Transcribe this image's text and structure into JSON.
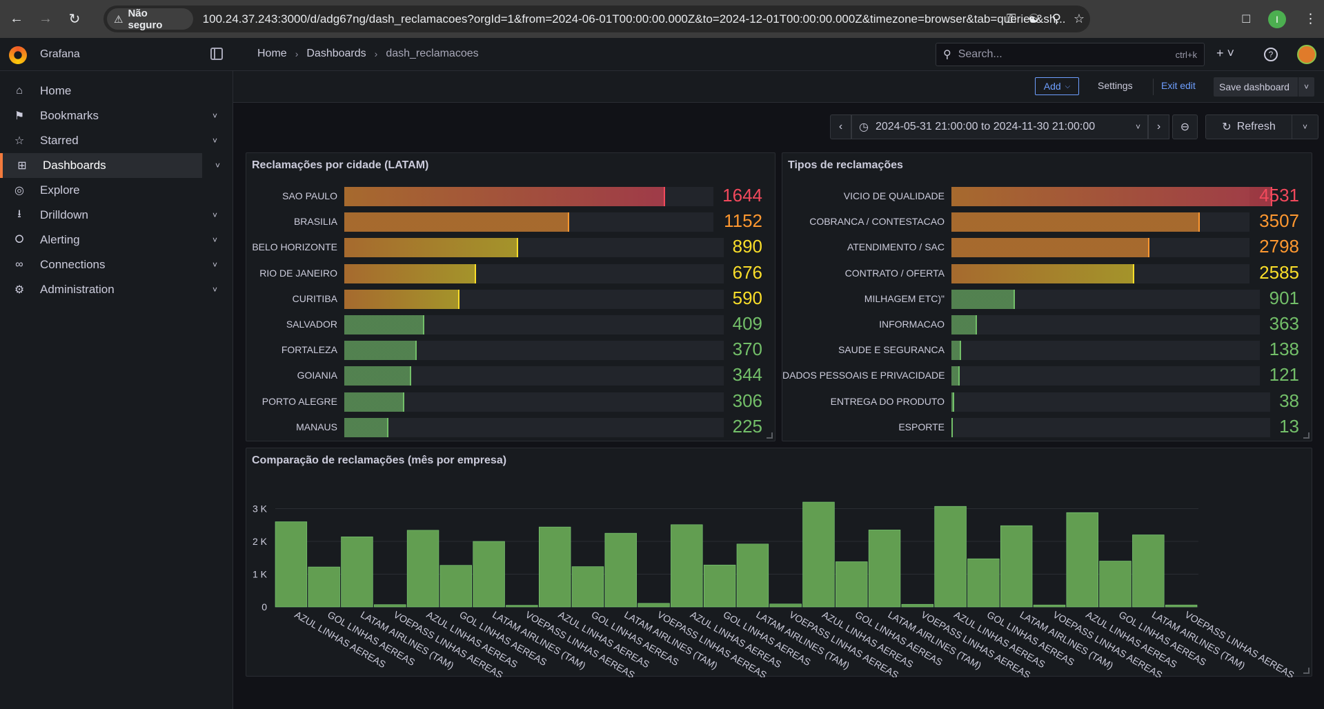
{
  "browser": {
    "security_label": "Não seguro",
    "url": "100.24.37.243:3000/d/adg67ng/dash_reclamacoes?orgId=1&from=2024-06-01T00:00:00.000Z&to=2024-12-01T00:00:00.000Z&timezone=browser&tab=queries&sh...",
    "profile_initial": "I"
  },
  "app": {
    "brand": "Grafana",
    "breadcrumb": [
      "Home",
      "Dashboards",
      "dash_reclamacoes"
    ],
    "search_placeholder": "Search...",
    "search_shortcut": "ctrl+k"
  },
  "sidebar": {
    "items": [
      {
        "label": "Home",
        "icon": "home-icon",
        "chevron": false,
        "active": false
      },
      {
        "label": "Bookmarks",
        "icon": "bookmark-icon",
        "chevron": true,
        "active": false
      },
      {
        "label": "Starred",
        "icon": "star-icon",
        "chevron": true,
        "active": false
      },
      {
        "label": "Dashboards",
        "icon": "dashboards-grid-icon",
        "chevron": true,
        "active": true
      },
      {
        "label": "Explore",
        "icon": "compass-icon",
        "chevron": false,
        "active": false
      },
      {
        "label": "Drilldown",
        "icon": "drilldown-icon",
        "chevron": true,
        "active": false
      },
      {
        "label": "Alerting",
        "icon": "bell-icon",
        "chevron": true,
        "active": false
      },
      {
        "label": "Connections",
        "icon": "connections-icon",
        "chevron": true,
        "active": false
      },
      {
        "label": "Administration",
        "icon": "gear-icon",
        "chevron": true,
        "active": false
      }
    ]
  },
  "toolbar": {
    "add_label": "Add",
    "settings_label": "Settings",
    "exit_edit_label": "Exit edit",
    "save_label": "Save dashboard"
  },
  "time": {
    "range": "2024-05-31 21:00:00 to 2024-11-30 21:00:00",
    "refresh_label": "Refresh"
  },
  "colors": {
    "red": "#f2495c",
    "orange": "#ff9830",
    "yellow": "#fade2a",
    "green": "#73bf69",
    "bar_green": "#629e51"
  },
  "panels": {
    "cities": {
      "title": "Reclamações por cidade (LATAM)",
      "max": 1644,
      "rows": [
        {
          "label": "SAO PAULO",
          "value": "1644"
        },
        {
          "label": "BRASILIA",
          "value": "1152"
        },
        {
          "label": "BELO HORIZONTE",
          "value": "890"
        },
        {
          "label": "RIO DE JANEIRO",
          "value": "676"
        },
        {
          "label": "CURITIBA",
          "value": "590"
        },
        {
          "label": "SALVADOR",
          "value": "409"
        },
        {
          "label": "FORTALEZA",
          "value": "370"
        },
        {
          "label": "GOIANIA",
          "value": "344"
        },
        {
          "label": "PORTO ALEGRE",
          "value": "306"
        },
        {
          "label": "MANAUS",
          "value": "225"
        }
      ]
    },
    "types": {
      "title": "Tipos de reclamações",
      "max": 4531,
      "rows": [
        {
          "label": "VICIO DE QUALIDADE",
          "value": "4531"
        },
        {
          "label": "COBRANCA / CONTESTACAO",
          "value": "3507"
        },
        {
          "label": "ATENDIMENTO / SAC",
          "value": "2798"
        },
        {
          "label": "CONTRATO / OFERTA",
          "value": "2585"
        },
        {
          "label": "MILHAGEM ETC)\"",
          "value": "901"
        },
        {
          "label": "INFORMACAO",
          "value": "363"
        },
        {
          "label": "SAUDE E SEGURANCA",
          "value": "138"
        },
        {
          "label": "DADOS PESSOAIS E PRIVACIDADE",
          "value": "121"
        },
        {
          "label": "ENTREGA DO PRODUTO",
          "value": "38"
        },
        {
          "label": "ESPORTE",
          "value": "13"
        }
      ]
    },
    "comparison": {
      "title": "Comparação de reclamações (mês por empresa)"
    }
  },
  "chart_data": {
    "type": "bar",
    "title": "Comparação de reclamações (mês por empresa)",
    "xlabel": "",
    "ylabel": "",
    "ylim": [
      0,
      3200
    ],
    "yticks": [
      "0",
      "1 K",
      "2 K",
      "3 K"
    ],
    "grid": true,
    "categories": [
      "AZUL LINHAS AEREAS",
      "GOL LINHAS AEREAS",
      "LATAM AIRLINES (TAM)",
      "VOEPASS LINHAS AEREAS",
      "AZUL LINHAS AEREAS",
      "GOL LINHAS AEREAS",
      "LATAM AIRLINES (TAM)",
      "VOEPASS LINHAS AEREAS",
      "AZUL LINHAS AEREAS",
      "GOL LINHAS AEREAS",
      "LATAM AIRLINES (TAM)",
      "VOEPASS LINHAS AEREAS",
      "AZUL LINHAS AEREAS",
      "GOL LINHAS AEREAS",
      "LATAM AIRLINES (TAM)",
      "VOEPASS LINHAS AEREAS",
      "AZUL LINHAS AEREAS",
      "GOL LINHAS AEREAS",
      "LATAM AIRLINES (TAM)",
      "VOEPASS LINHAS AEREAS",
      "AZUL LINHAS AEREAS",
      "GOL LINHAS AEREAS",
      "LATAM AIRLINES (TAM)",
      "VOEPASS LINHAS AEREAS",
      "AZUL LINHAS AEREAS",
      "GOL LINHAS AEREAS",
      "LATAM AIRLINES (TAM)",
      "VOEPASS LINHAS AEREAS"
    ],
    "values": [
      2600,
      1220,
      2140,
      70,
      2340,
      1270,
      2000,
      50,
      2440,
      1230,
      2250,
      110,
      2510,
      1280,
      1920,
      90,
      3200,
      1380,
      2350,
      80,
      3070,
      1470,
      2480,
      60,
      2880,
      1400,
      2200,
      60
    ]
  }
}
